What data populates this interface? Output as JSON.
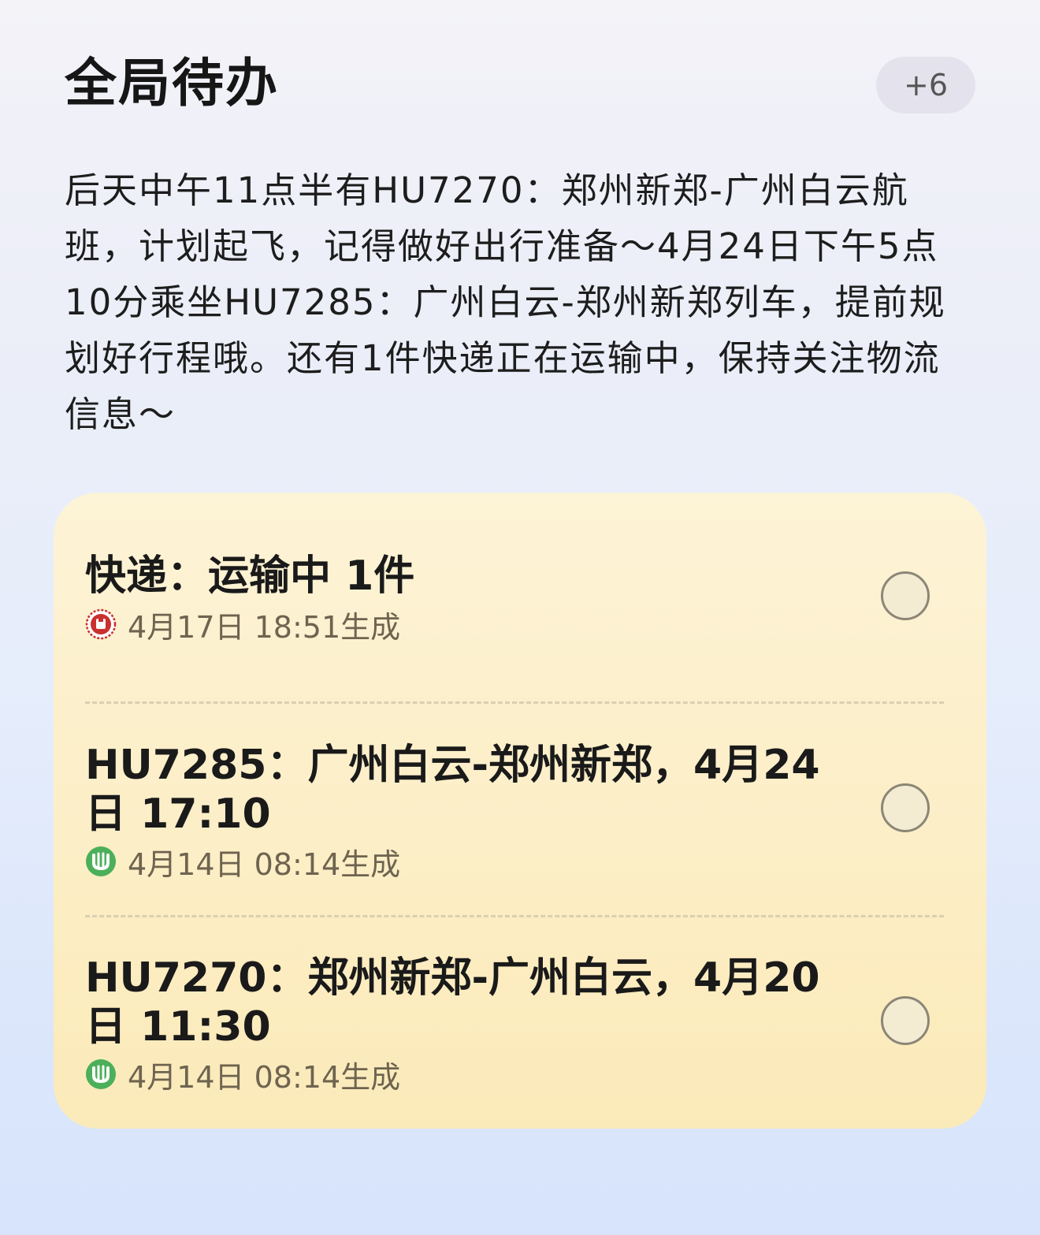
{
  "header": {
    "title": "全局待办",
    "more_count": "+6"
  },
  "summary": "后天中午11点半有HU7270：郑州新郑-广州白云航班，计划起飞，记得做好出行准备～4月24日下午5点10分乘坐HU7285：广州白云-郑州新郑列车，提前规划好行程哦。还有1件快递正在运输中，保持关注物流信息～",
  "items": [
    {
      "title": "快递：运输中 1件",
      "meta": "4月17日 18:51生成",
      "icon": "express-app-icon"
    },
    {
      "title": "HU7285：广州白云-郑州新郑，4月24日 17:10",
      "meta": "4月14日 08:14生成",
      "icon": "travel-app-icon"
    },
    {
      "title": "HU7270：郑州新郑-广州白云，4月20日 11:30",
      "meta": "4月14日 08:14生成",
      "icon": "travel-app-icon"
    }
  ],
  "colors": {
    "card_top": "#fdf3d6",
    "card_bottom": "#fbeab9",
    "express_icon": "#c9312f",
    "travel_icon": "#4caf5a"
  }
}
